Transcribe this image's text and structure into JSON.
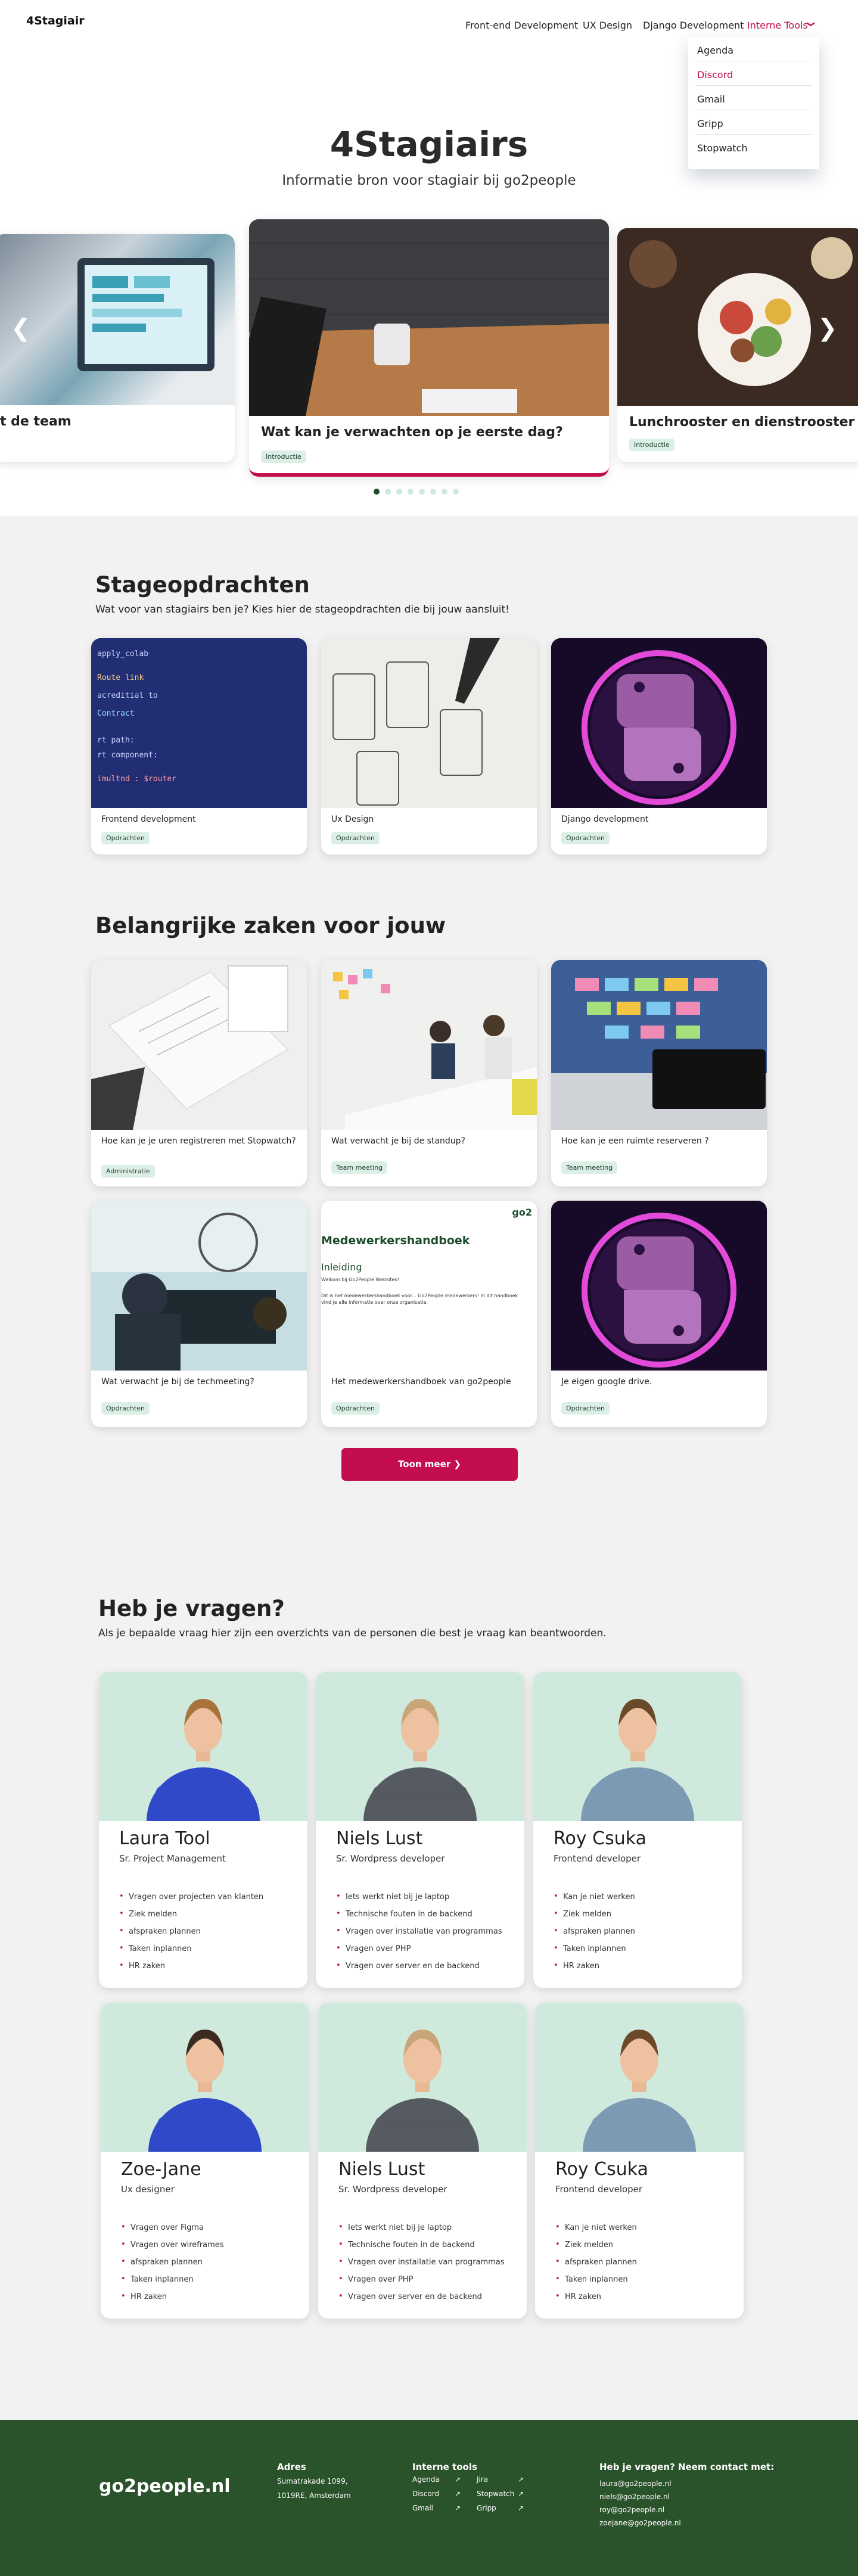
{
  "nav": {
    "logo": "4Stagiair",
    "links": [
      "Front-end Development",
      "UX Design",
      "Django Development"
    ],
    "dropdown_label": "Interne Tools",
    "dropdown_items": [
      "Agenda",
      "Discord",
      "Gmail",
      "Gripp",
      "Stopwatch"
    ]
  },
  "hero": {
    "title": "4Stagiairs",
    "subtitle": "Informatie bron voor stagiair bij go2people"
  },
  "carousel": {
    "slides": [
      {
        "title": "t de team"
      },
      {
        "title": "Wat kan je verwachten op je eerste dag?",
        "tag": "Introductie"
      },
      {
        "title": "Lunchrooster en dienstrooster",
        "tag": "Introductie"
      }
    ]
  },
  "stage": {
    "title": "Stageopdrachten",
    "subtitle": "Wat voor van stagiairs ben je? Kies hier de stageopdrachten die bij jouw aansluit!",
    "cards": [
      {
        "title": "Frontend development",
        "tag": "Opdrachten"
      },
      {
        "title": "Ux Design",
        "tag": "Opdrachten"
      },
      {
        "title": "Django development",
        "tag": "Opdrachten"
      }
    ]
  },
  "important": {
    "title": "Belangrijke zaken voor jouw",
    "cards": [
      {
        "title": "Hoe kan je je uren registreren met Stopwatch?",
        "tag": "Administratie"
      },
      {
        "title": "Wat verwacht je bij de standup?",
        "tag": "Team meeting"
      },
      {
        "title": "Hoe kan je een ruimte reserveren ?",
        "tag": "Team meeting"
      },
      {
        "title": "Wat verwacht je bij de techmeeting?",
        "tag": "Opdrachten"
      },
      {
        "title": "Het medewerkershandboek van go2people",
        "tag": "Opdrachten"
      },
      {
        "title": "Je eigen google drive.",
        "tag": "Opdrachten"
      }
    ],
    "handbook_preview": {
      "logo": "go2",
      "heading": "Medewerkershandboek",
      "subheading": "Inleiding",
      "line1": "Welkom bij Go2People Websites!",
      "line2": "Dit is het medewerkershandboek voor... Go2People medewerkers! In dit handboek",
      "line3": "vind je alle informatie over onze organisatie."
    },
    "button": "Toon meer"
  },
  "questions": {
    "title": "Heb je vragen?",
    "subtitle": "Als je bepaalde vraag hier zijn een overzichts van de personen die  best je vraag kan beantwoorden.",
    "people": [
      {
        "name": "Laura Tool",
        "role": "Sr. Project Management",
        "tasks": [
          "Vragen over projecten van klanten",
          "Ziek melden",
          "afspraken plannen",
          "Taken inplannen",
          "HR zaken"
        ]
      },
      {
        "name": "Niels Lust",
        "role": "Sr. Wordpress developer",
        "tasks": [
          "Iets werkt niet bij  je laptop",
          "Technische fouten in de backend",
          "Vragen over installatie van programmas",
          "Vragen over PHP",
          "Vragen over server en de backend"
        ]
      },
      {
        "name": "Roy Csuka",
        "role": "Frontend developer",
        "tasks": [
          "Kan je niet werken",
          "Ziek melden",
          "afspraken plannen",
          "Taken inplannen",
          "HR zaken"
        ]
      },
      {
        "name": "Zoe-Jane",
        "role": "Ux designer",
        "tasks": [
          "Vragen  over Figma",
          "Vragen over wireframes",
          "afspraken plannen",
          "Taken inplannen",
          "HR zaken"
        ]
      },
      {
        "name": "Niels Lust",
        "role": "Sr. Wordpress developer",
        "tasks": [
          "Iets werkt niet bij  je laptop",
          "Technische fouten in de backend",
          "Vragen over installatie van programmas",
          "Vragen over PHP",
          "Vragen over server en de backend"
        ]
      },
      {
        "name": "Roy Csuka",
        "role": "Frontend developer",
        "tasks": [
          "Kan je niet werken",
          "Ziek melden",
          "afspraken plannen",
          "Taken inplannen",
          "HR zaken"
        ]
      }
    ]
  },
  "footer": {
    "brand": "go2people.nl",
    "address_title": "Adres",
    "address_lines": [
      "Sumatrakade 1099,",
      "1019RE, Amsterdam"
    ],
    "tools_title": "Interne tools",
    "tools": [
      "Agenda",
      "Discord",
      "Gmail",
      "Jira",
      "Stopwatch",
      "Gripp"
    ],
    "contact_title": "Heb je vragen? Neem contact met:",
    "contacts": [
      "laura@go2people.nl",
      "niels@go2people.nl",
      "roy@go2people.nl",
      "zoejane@go2people.nl"
    ]
  },
  "colors": {
    "accent": "#c30d4f",
    "tag_bg": "#dcefe7",
    "footer_bg": "#2b532b",
    "person_bg": "#cfeadd"
  }
}
